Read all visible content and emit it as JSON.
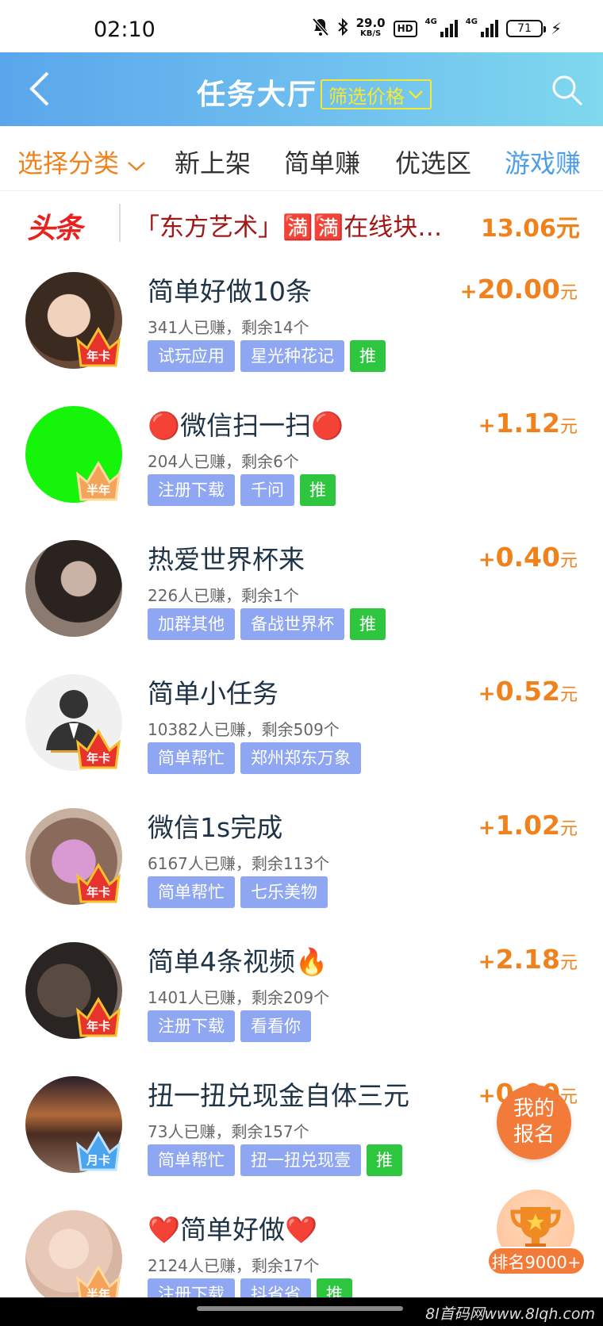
{
  "status_bar": {
    "time": "02:10",
    "net_speed": "29.0",
    "net_unit": "KB/S",
    "hd": "HD",
    "net_type_1": "4G",
    "net_type_2": "4G",
    "battery": "71"
  },
  "header": {
    "title": "任务大厅",
    "filter_label": "筛选价格"
  },
  "tabs": {
    "category": "选择分类",
    "new": "新上架",
    "simple": "简单赚",
    "selected": "优选区",
    "game": "游戏赚"
  },
  "ticker": {
    "logo": "头条",
    "text": "「东方艺术」🈵🈵在线块…",
    "amount": "13.06元"
  },
  "tasks": [
    {
      "title": "简单好做10条",
      "meta": "341人已赚，剩余14个",
      "tags": [
        "试玩应用",
        "星光种花记",
        "推"
      ],
      "reward": "20.00",
      "badge": "年卡"
    },
    {
      "title": "🔴微信扫一扫🔴",
      "meta": "204人已赚，剩余6个",
      "tags": [
        "注册下载",
        "千问",
        "推"
      ],
      "reward": "1.12",
      "badge": "半年"
    },
    {
      "title": "热爱世界杯来",
      "meta": "226人已赚，剩余1个",
      "tags": [
        "加群其他",
        "备战世界杯",
        "推"
      ],
      "reward": "0.40",
      "badge": ""
    },
    {
      "title": "简单小任务",
      "meta": "10382人已赚，剩余509个",
      "tags": [
        "简单帮忙",
        "郑州郑东万象"
      ],
      "reward": "0.52",
      "badge": "年卡"
    },
    {
      "title": "微信1s完成",
      "meta": "6167人已赚，剩余113个",
      "tags": [
        "简单帮忙",
        "七乐美物"
      ],
      "reward": "1.02",
      "badge": "年卡"
    },
    {
      "title": "简单4条视频🔥",
      "meta": "1401人已赚，剩余209个",
      "tags": [
        "注册下载",
        "看看你"
      ],
      "reward": "2.18",
      "badge": "年卡"
    },
    {
      "title": "扭一扭兑现金自体三元",
      "meta": "73人已赚，剩余157个",
      "tags": [
        "简单帮忙",
        "扭一扭兑现壹",
        "推"
      ],
      "reward": "0.00",
      "badge": "月卡"
    },
    {
      "title": "❤️简单好做❤️",
      "meta": "2124人已赚，剩余17个",
      "tags": [
        "注册下载",
        "抖省省",
        "推"
      ],
      "reward": "",
      "badge": "半年"
    }
  ],
  "reward_unit": "元",
  "reward_plus": "+",
  "fab": {
    "signup_line1": "我的",
    "signup_line2": "报名",
    "rank": "排名9000+"
  },
  "watermark": "8l首码网www.8lqh.com",
  "colors": {
    "accent": "#f0821e",
    "header_start": "#5aa6ec",
    "header_end": "#7fd8ee",
    "tag": "#8fa7f2",
    "tag_hot": "#2ec63f",
    "fab": "#f37b3a"
  }
}
